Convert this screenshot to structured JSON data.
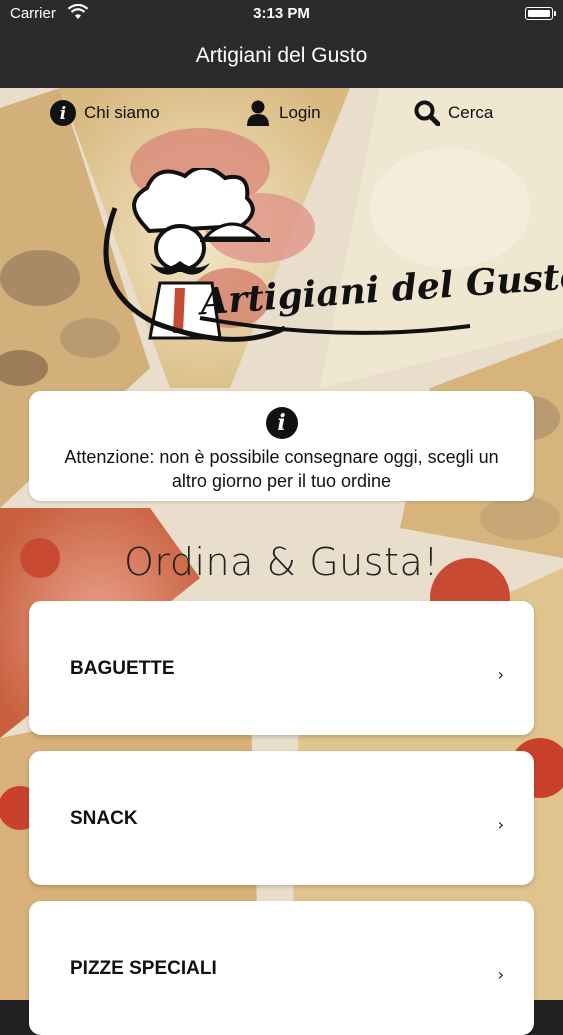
{
  "status_bar": {
    "carrier": "Carrier",
    "time": "3:13 PM"
  },
  "nav": {
    "title": "Artigiani del Gusto"
  },
  "quick_nav": [
    {
      "label": "Chi siamo",
      "icon": "info-icon"
    },
    {
      "label": "Login",
      "icon": "user-icon"
    },
    {
      "label": "Cerca",
      "icon": "search-icon"
    }
  ],
  "logo": {
    "text": "Artigiani del Gusto"
  },
  "notice": {
    "icon": "info-icon",
    "message": "Attenzione: non è possibile consegnare oggi, scegli un altro giorno per il tuo ordine"
  },
  "section_title": "Ordina & Gusta!",
  "categories": [
    {
      "label": "BAGUETTE",
      "chevron": "›"
    },
    {
      "label": "SNACK",
      "chevron": "›"
    },
    {
      "label": "PIZZE SPECIALI",
      "chevron": "›"
    }
  ],
  "colors": {
    "navbar": "#2b2b2b",
    "card": "#ffffff",
    "text": "#111111"
  }
}
